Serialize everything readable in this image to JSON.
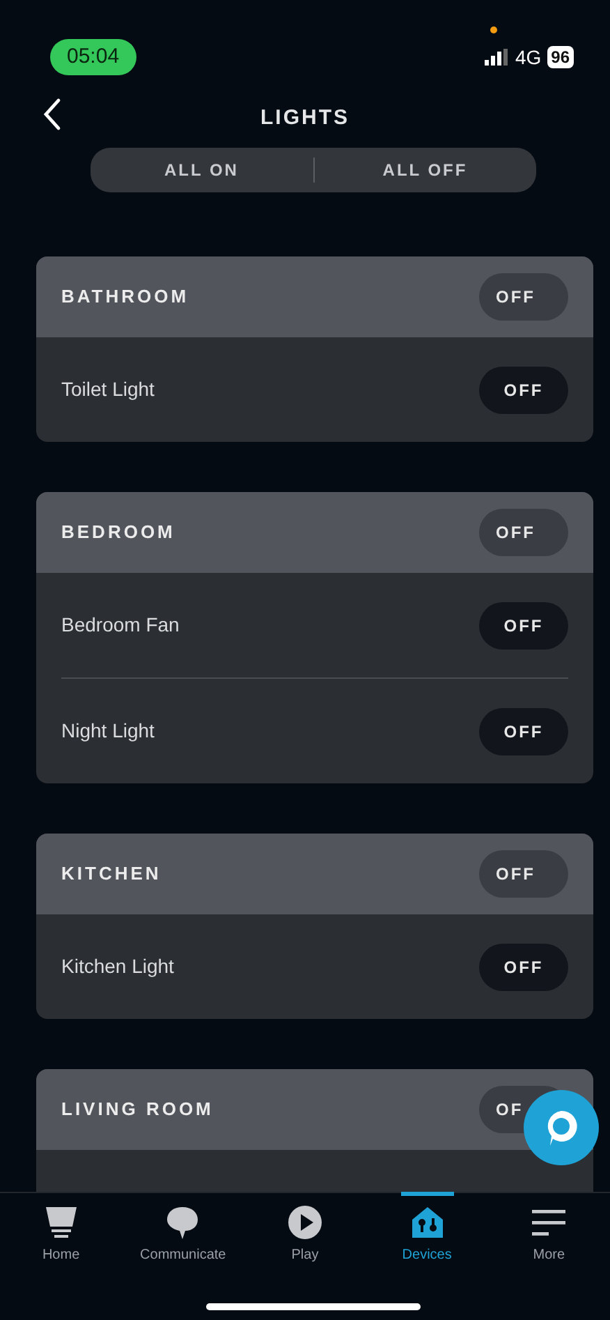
{
  "status_bar": {
    "time": "05:04",
    "network": "4G",
    "battery": "96"
  },
  "header": {
    "title": "LIGHTS"
  },
  "segment": [
    {
      "label": "ALL ON"
    },
    {
      "label": "ALL OFF"
    }
  ],
  "groups": [
    {
      "name": "BATHROOM",
      "toggle": "OFF",
      "devices": [
        {
          "name": "Toilet Light",
          "toggle": "OFF"
        }
      ]
    },
    {
      "name": "BEDROOM",
      "toggle": "OFF",
      "devices": [
        {
          "name": "Bedroom Fan",
          "toggle": "OFF"
        },
        {
          "name": "Night Light",
          "toggle": "OFF"
        }
      ]
    },
    {
      "name": "KITCHEN",
      "toggle": "OFF",
      "devices": [
        {
          "name": "Kitchen Light",
          "toggle": "OFF"
        }
      ]
    },
    {
      "name": "LIVING ROOM",
      "toggle": "OF"
    }
  ],
  "tabs": [
    {
      "label": "Home",
      "kind": "home",
      "selected": false
    },
    {
      "label": "Communicate",
      "kind": "communicate",
      "selected": false
    },
    {
      "label": "Play",
      "kind": "play",
      "selected": false
    },
    {
      "label": "Devices",
      "kind": "devices",
      "selected": true
    },
    {
      "label": "More",
      "kind": "more",
      "selected": false
    }
  ]
}
